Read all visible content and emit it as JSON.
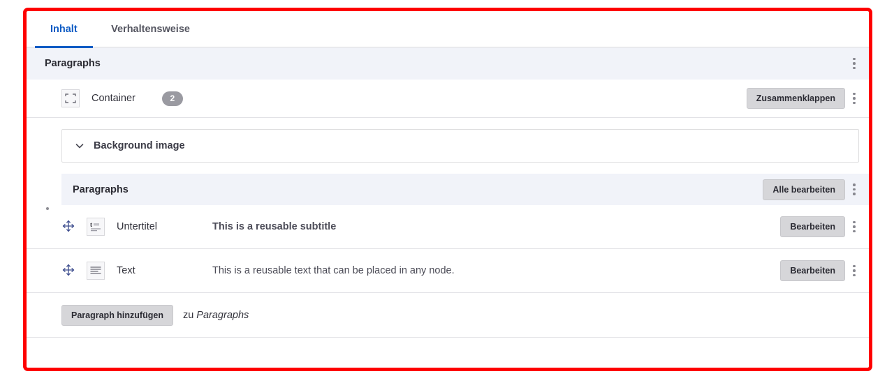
{
  "frame": {
    "accent_color": "#fe0000"
  },
  "tabs": {
    "items": [
      {
        "label": "Inhalt",
        "active": true
      },
      {
        "label": "Verhaltensweise",
        "active": false
      }
    ]
  },
  "outer_section": {
    "title": "Paragraphs",
    "menu_icon": "kebab-menu-icon"
  },
  "container_row": {
    "icon": "container-icon",
    "label": "Container",
    "count": "2",
    "collapse_button": "Zusammenklappen",
    "menu_icon": "kebab-menu-icon"
  },
  "background_image": {
    "label": "Background image",
    "chevron_icon": "chevron-down-icon"
  },
  "inner_section": {
    "title": "Paragraphs",
    "edit_all_button": "Alle bearbeiten",
    "menu_icon": "kebab-menu-icon"
  },
  "items": [
    {
      "drag_icon": "move-handle-icon",
      "type_icon": "subtitle-icon",
      "label": "Untertitel",
      "value": "This is a reusable subtitle",
      "bold": true,
      "edit_button": "Bearbeiten",
      "menu_icon": "kebab-menu-icon"
    },
    {
      "drag_icon": "move-handle-icon",
      "type_icon": "text-icon",
      "label": "Text",
      "value": "This is a reusable text that can be placed in any node.",
      "bold": false,
      "edit_button": "Bearbeiten",
      "menu_icon": "kebab-menu-icon"
    }
  ],
  "add_paragraph": {
    "button": "Paragraph hinzufügen",
    "suffix_prefix": "zu ",
    "suffix_target": "Paragraphs"
  }
}
